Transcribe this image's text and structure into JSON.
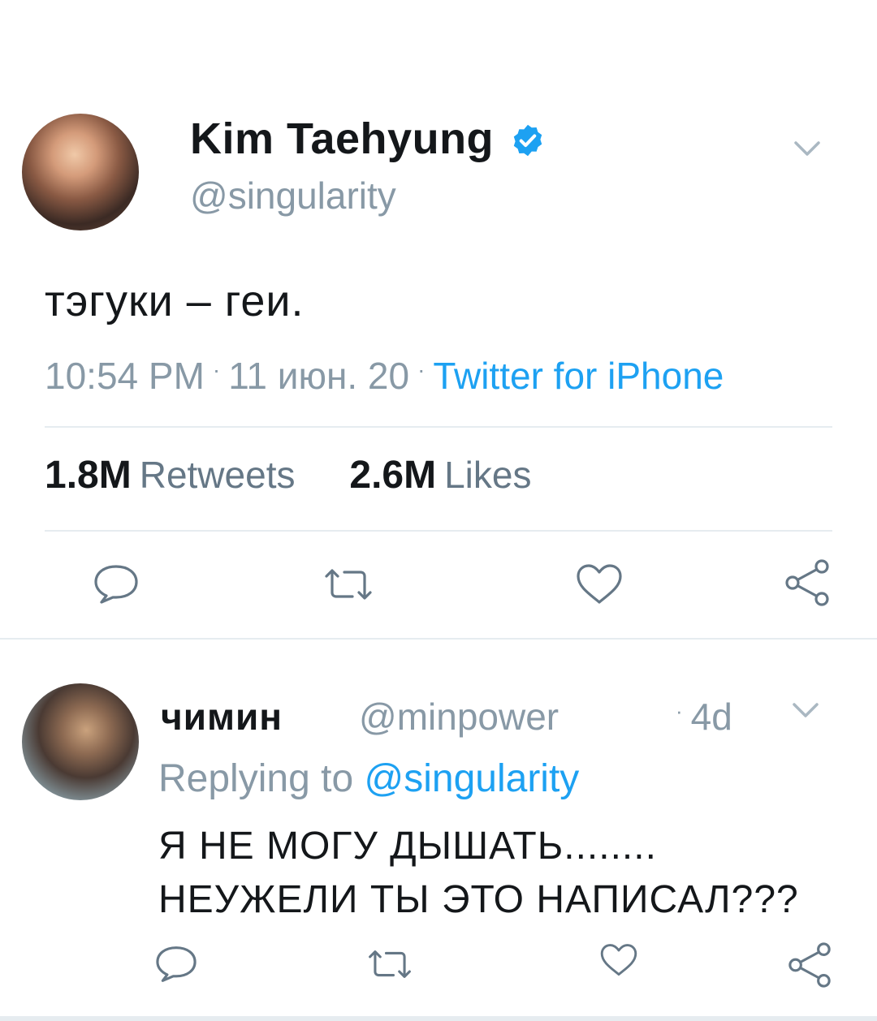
{
  "main_tweet": {
    "display_name": "Kim Taehyung",
    "handle": "@singularity",
    "text": "тэгуки – геи.",
    "time": "10:54 PM",
    "date": "11 июн. 20",
    "source": "Twitter for iPhone",
    "retweets_count": "1.8M",
    "retweets_label": "Retweets",
    "likes_count": "2.6M",
    "likes_label": "Likes"
  },
  "reply": {
    "display_name": "чимин",
    "handle": "@minpower",
    "time": "4d",
    "replying_prefix": "Replying to",
    "replying_mention": "@singularity",
    "text_line1": "Я НЕ МОГУ ДЫШАТЬ........",
    "text_line2": "НЕУЖЕЛИ ТЫ ЭТО НАПИСАЛ???"
  },
  "icons": {
    "verified": "verified-badge-icon",
    "more": "chevron-down-icon",
    "reply": "reply-bubble-icon",
    "retweet": "retweet-icon",
    "like": "heart-icon",
    "share": "share-icon"
  },
  "colors": {
    "accent": "#1da1f2",
    "secondary_text": "#8899a6",
    "divider": "#e6ecf0",
    "icon": "#657786"
  }
}
